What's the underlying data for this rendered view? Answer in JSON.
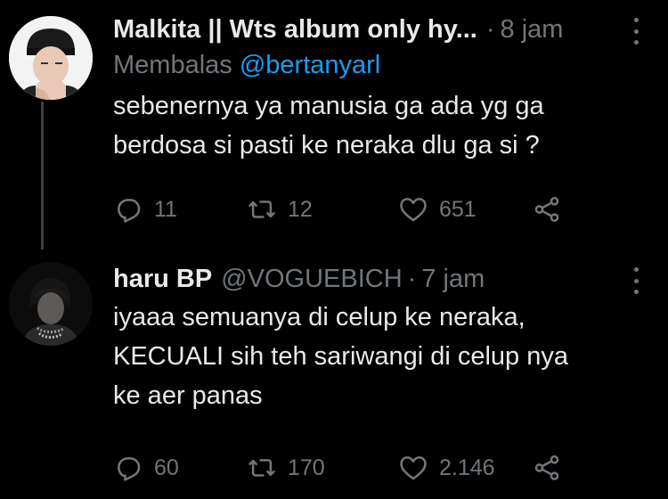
{
  "tweets": [
    {
      "name": "Malkita || Wts album only hy...",
      "handle": "",
      "time": "8 jam",
      "replying_prefix": "Membalas",
      "replying_mention": "@bertanyarl",
      "lines": [
        "sebenernya ya manusia ga ada yg ga",
        "berdosa si pasti ke neraka dlu ga si ?"
      ],
      "replies": "11",
      "retweets": "12",
      "likes": "651"
    },
    {
      "name": "haru BP",
      "handle": "@VOGUEBICH",
      "time": "7 jam",
      "lines": [
        "iyaaa semuanya di celup ke neraka,",
        "KECUALI sih teh sariwangi di celup nya",
        "ke aer panas"
      ],
      "replies": "60",
      "retweets": "170",
      "likes": "2.146"
    }
  ],
  "icons": [
    "reply-icon",
    "retweet-icon",
    "like-icon",
    "share-icon",
    "more-icon"
  ],
  "colors": {
    "background": "#000000",
    "text": "#e7e9ea",
    "muted": "#71767b",
    "link": "#1d9bf0"
  }
}
